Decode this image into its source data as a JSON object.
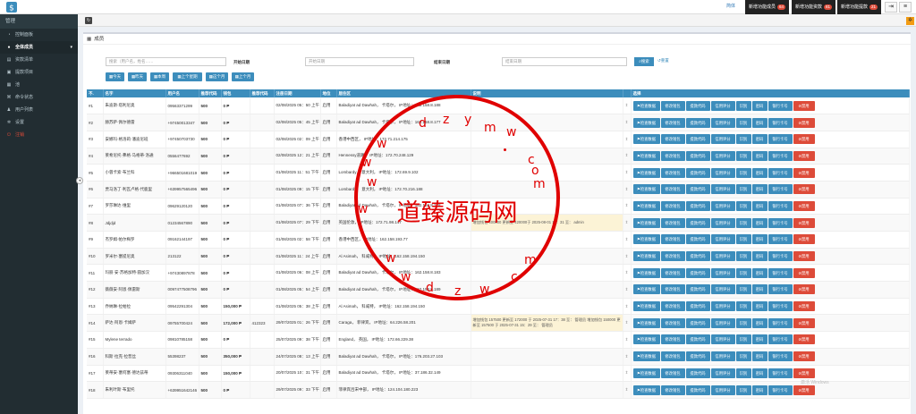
{
  "topbar": {
    "lang": "简体",
    "btn1_label": "新增功能成员",
    "btn1_count": "64",
    "btn2_label": "新增功能资款",
    "btn2_count": "81",
    "btn3_label": "新增功能提款",
    "btn3_count": "21"
  },
  "sidebar": {
    "header": "管理",
    "items": [
      {
        "label": "控制面板",
        "icon": "dashboard-icon"
      },
      {
        "label": "全体成员",
        "icon": "users-icon",
        "arrow": "▾"
      },
      {
        "label": "资款清单",
        "icon": "list-icon"
      },
      {
        "label": "提款项目",
        "icon": "money-icon"
      },
      {
        "label": "池",
        "icon": "grid-icon"
      },
      {
        "label": "命令状态",
        "icon": "command-icon"
      },
      {
        "label": "用户列表",
        "icon": "user-icon"
      },
      {
        "label": "设置",
        "icon": "gear-icon"
      },
      {
        "label": "注销",
        "icon": "logout-icon"
      }
    ]
  },
  "panel": {
    "title": "成员"
  },
  "filter": {
    "search_placeholder": "搜索（用户名，姓名……",
    "start_label": "开始日期",
    "start_placeholder": "开始日期",
    "end_label": "结束日期",
    "end_placeholder": "结束日期",
    "search_btn": "搜索",
    "reset": "重置",
    "quick": [
      "今天",
      "昨天",
      "本周",
      "上个星期",
      "这个月",
      "上个月"
    ]
  },
  "table": {
    "headers": [
      "不.",
      "名字",
      "用户名",
      "推荐代码",
      "钱包",
      "推荐代码",
      "注册日期",
      "地位",
      "居住区",
      "说明",
      "",
      "选择"
    ],
    "status_text": "启用",
    "rows": [
      {
        "no": "#1",
        "name": "朱迪斯·塔利尼奥",
        "user": "09563371299",
        "ref": "500",
        "wallet": "0 ₱",
        "ref2": "",
        "date": "02/08/2025 05：50 上午",
        "loc": "Baladiyat ad Dawhah， 卡塔尔， IP地址：162.158.8.188",
        "remark": ""
      },
      {
        "no": "#2",
        "name": "赫苏萨·佩尔德雷",
        "user": "+97450013347",
        "ref": "500",
        "wallet": "0 ₱",
        "ref2": "",
        "date": "02/08/2025 05：45 上午",
        "loc": "Baladiyat ad Dawhah， 卡塔尔， IP地址：162.158.8.177",
        "remark": ""
      },
      {
        "no": "#3",
        "name": "安娜玛·格洛莉·潘迪尼班",
        "user": "+97450703730",
        "ref": "500",
        "wallet": "0 ₱",
        "ref2": "",
        "date": "02/08/2025 02：09 上午",
        "loc": "香港中西区， IP地址：172.71.214.175",
        "remark": ""
      },
      {
        "no": "#4",
        "name": "莱希尼托·弗格·马格蒂·洛通",
        "user": "0556477692",
        "ref": "500",
        "wallet": "0 ₱",
        "ref2": "",
        "date": "02/08/2025 12：21 上午",
        "loc": "Hennessy道路， IP地址：172.70.248.129",
        "remark": ""
      },
      {
        "no": "#5",
        "name": "小蓉卡索·布兰科",
        "user": "+966501681019",
        "ref": "500",
        "wallet": "0 ₱",
        "ref2": "",
        "date": "01/08/2025 11：51 下午",
        "loc": "Lombardy， 意大利， IP地址：172.69.9.102",
        "remark": ""
      },
      {
        "no": "#6",
        "name": "贾马洛丁·利瓦卢格·代鹿里",
        "user": "+639957565496",
        "ref": "500",
        "wallet": "0 ₱",
        "ref2": "",
        "date": "01/08/2025 09：15 下午",
        "loc": "Lombardy， 意大利， IP地址：172.70.216.188",
        "remark": ""
      },
      {
        "no": "#7",
        "name": "罗莎琳达·维里",
        "user": "09629120120",
        "ref": "500",
        "wallet": "0 ₱",
        "ref2": "",
        "date": "01/08/2025 07：36 下午",
        "loc": "Baladiyat ad Dawhah， 卡塔尔， IP地址：162.158.8.178",
        "remark": ""
      },
      {
        "no": "#8",
        "name": "Jdjdjd",
        "user": "01234567890",
        "ref": "500",
        "wallet": "0 ₱",
        "ref2": "",
        "date": "01/08/2025 07：29 下午",
        "loc": "英国伦敦， IP地址：172.71.98.147",
        "remark": "增加钱包 400000 更新至 420000于 2025-08-01 14：31 至： admin"
      },
      {
        "no": "#9",
        "name": "杰罗姆·帕尔梅罗",
        "user": "09162144197",
        "ref": "500",
        "wallet": "0 ₱",
        "ref2": "",
        "date": "01/08/2025 02：58 下午",
        "loc": "香港中西区， IP地址：162.158.193.77",
        "remark": ""
      },
      {
        "no": "#10",
        "name": "罗米尔·塞提尼奥",
        "user": "213122",
        "ref": "500",
        "wallet": "0 ₱",
        "ref2": "",
        "date": "01/08/2025 11：24 上午",
        "loc": "Al Asimah， 科威特， IP地址：162.158.194.150",
        "remark": ""
      },
      {
        "no": "#11",
        "name": "玛丽·安·苏格加特·圆加汉",
        "user": "+97430897878",
        "ref": "500",
        "wallet": "0 ₱",
        "ref2": "",
        "date": "01/08/2025 06：08 上午",
        "loc": "Baladiyat ad Dawhah， 卡塔尔， IP地址：162.158.8.183",
        "remark": ""
      },
      {
        "no": "#12",
        "name": "薇薇安·阿恩·佩雷斯",
        "user": "0097477508796",
        "ref": "500",
        "wallet": "0 ₱",
        "ref2": "",
        "date": "01/08/2025 05：54 上午",
        "loc": "Baladiyat ad Dawhah， 卡塔尔， IP地址：162.158.8.189",
        "remark": ""
      },
      {
        "no": "#13",
        "name": "乔纳琳·拉帕拉",
        "user": "09542291304",
        "ref": "500",
        "wallet": "150,000 ₱",
        "ref2": "",
        "date": "01/08/2025 05：38 上午",
        "loc": "Al Asimah， 科威特， IP地址：162.158.194.150",
        "remark": ""
      },
      {
        "no": "#14",
        "name": "萨达·阿恩·卡姆萨",
        "user": "09755700424",
        "ref": "500",
        "wallet": "172,000 ₱",
        "ref2": "412323",
        "date": "29/07/2025 01：26 下午",
        "loc": "Caraga， 菲律宾， IP地址：64.226.58.201",
        "remark": "增加钱包 157500 更新至 172000 于 2025-07-31 17：38 至： 管理员 增加钱包 150000 更新至 157500 于 2025-07-31 15：29 至： 管理员"
      },
      {
        "no": "#15",
        "name": "Mylene terrado",
        "user": "09810785158",
        "ref": "500",
        "wallet": "0 ₱",
        "ref2": "",
        "date": "25/07/2025 09：38 下午",
        "loc": "England， 英国， IP地址：172.66.229.38",
        "remark": ""
      },
      {
        "no": "#16",
        "name": "科斯·拉克·拉普丝",
        "user": "55398237",
        "ref": "500",
        "wallet": "350,000 ₱",
        "ref2": "",
        "date": "24/07/2025 08：13 上午",
        "loc": "Baladiyat ad Dawhah， 卡塔尔， IP地址：176.203.27.103",
        "remark": ""
      },
      {
        "no": "#17",
        "name": "莱蒂安·塞何塞·德达兹蒂",
        "user": "09306311040",
        "ref": "500",
        "wallet": "150,000 ₱",
        "ref2": "",
        "date": "20/07/2025 10：31 下午",
        "loc": "Baladiyat ad Dawhah， 卡塔尔， IP地址：37.186.32.149",
        "remark": ""
      },
      {
        "no": "#18",
        "name": "朱利叶斯·布里托",
        "user": "+639951642146",
        "ref": "500",
        "wallet": "0 ₱",
        "ref2": "",
        "date": "29/07/2025 09：33 下午",
        "loc": "菲律宾吕宋中部， IP地址：124.104.180.223",
        "remark": ""
      }
    ],
    "actions": [
      "检查数据",
      "修改钱包",
      "提款代码",
      "信用评分",
      "识别",
      "密码",
      "银行卡号",
      "禁用"
    ]
  },
  "watermark": {
    "text": "道臻源码网",
    "letters": "dzymw.com"
  },
  "win_mark": "激活 Windows",
  "colors": {
    "primary": "#3c8dbc",
    "danger": "#dd4b39",
    "sidebar": "#222d32",
    "stamp": "#e00000"
  }
}
